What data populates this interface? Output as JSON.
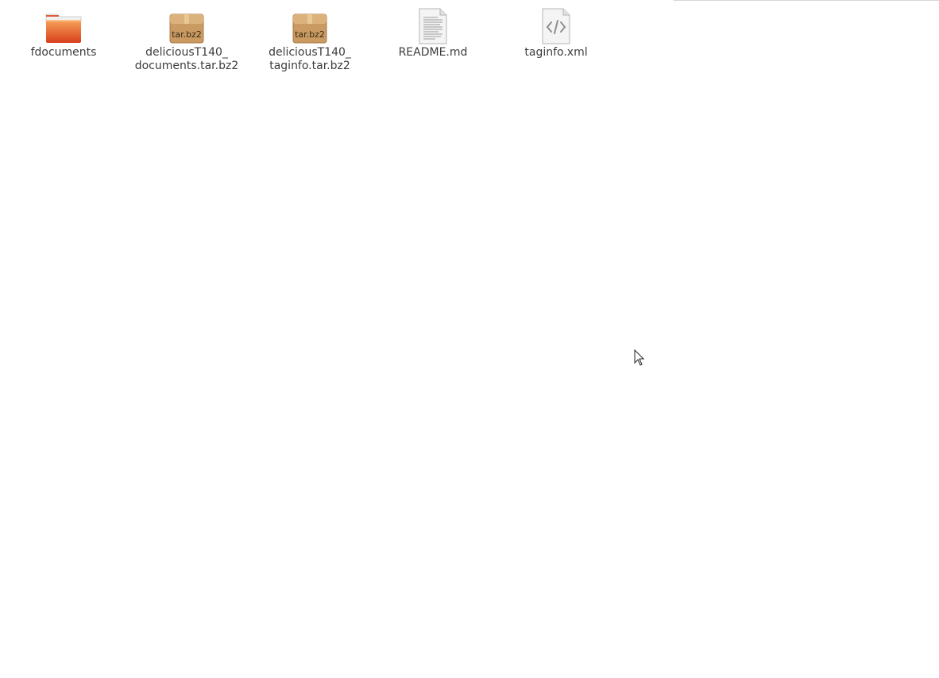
{
  "files": [
    {
      "name": "fdocuments",
      "icon": "folder-icon",
      "color": "#e0522a"
    },
    {
      "name": "deliciousT140_\ndocuments.tar.bz2",
      "icon": "archive-icon",
      "badge": "tar.bz2"
    },
    {
      "name": "deliciousT140_\ntaginfo.tar.bz2",
      "icon": "archive-icon",
      "badge": "tar.bz2"
    },
    {
      "name": "README.md",
      "icon": "text-file-icon"
    },
    {
      "name": "taginfo.xml",
      "icon": "xml-file-icon"
    }
  ],
  "cursor": {
    "icon": "mouse-pointer-icon"
  }
}
